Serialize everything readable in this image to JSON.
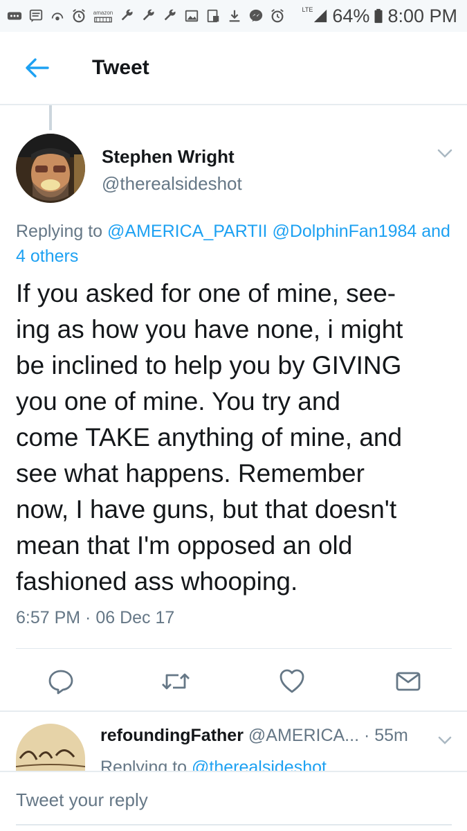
{
  "status_bar": {
    "icons": [
      "more-icon",
      "message-icon",
      "hotspot-icon",
      "alarm-icon",
      "amazon-icon",
      "wrench-icon",
      "wrench-icon",
      "wrench-icon",
      "image-icon",
      "screenshot-icon",
      "download-icon",
      "messenger-icon",
      "alarm-icon"
    ],
    "amazon_label": "amazon",
    "network": "LTE",
    "battery": "64%",
    "time": "8:00 PM"
  },
  "header": {
    "title": "Tweet"
  },
  "tweet": {
    "author_name": "Stephen Wright",
    "author_handle": "@therealsideshot",
    "replying_prefix": "Replying to",
    "replying_mentions": [
      "@AMERICA_PARTII",
      "@DolphinFan1984"
    ],
    "replying_others": "and 4 others",
    "text": "If you asked for one of mine, see-\ning as how you have none, i might\nbe inclined to help you by GIVING\nyou one of mine. You try and\ncome TAKE anything of mine, and\nsee what happens. Remember\nnow, I have guns, but that doesn't\nmean that I'm opposed an old\nfashioned ass whooping.",
    "timestamp": "6:57 PM · 06 Dec 17"
  },
  "next_reply": {
    "author_name": "refoundingFather",
    "author_handle": "@AMERICA...",
    "age": "· 55m",
    "replying_prefix": "Replying to",
    "replying_mention": "@therealsideshot"
  },
  "compose": {
    "placeholder": "Tweet your reply"
  },
  "colors": {
    "accent": "#1da1f2",
    "text": "#14171a",
    "secondary": "#657786",
    "divider": "#e6ecf0"
  }
}
